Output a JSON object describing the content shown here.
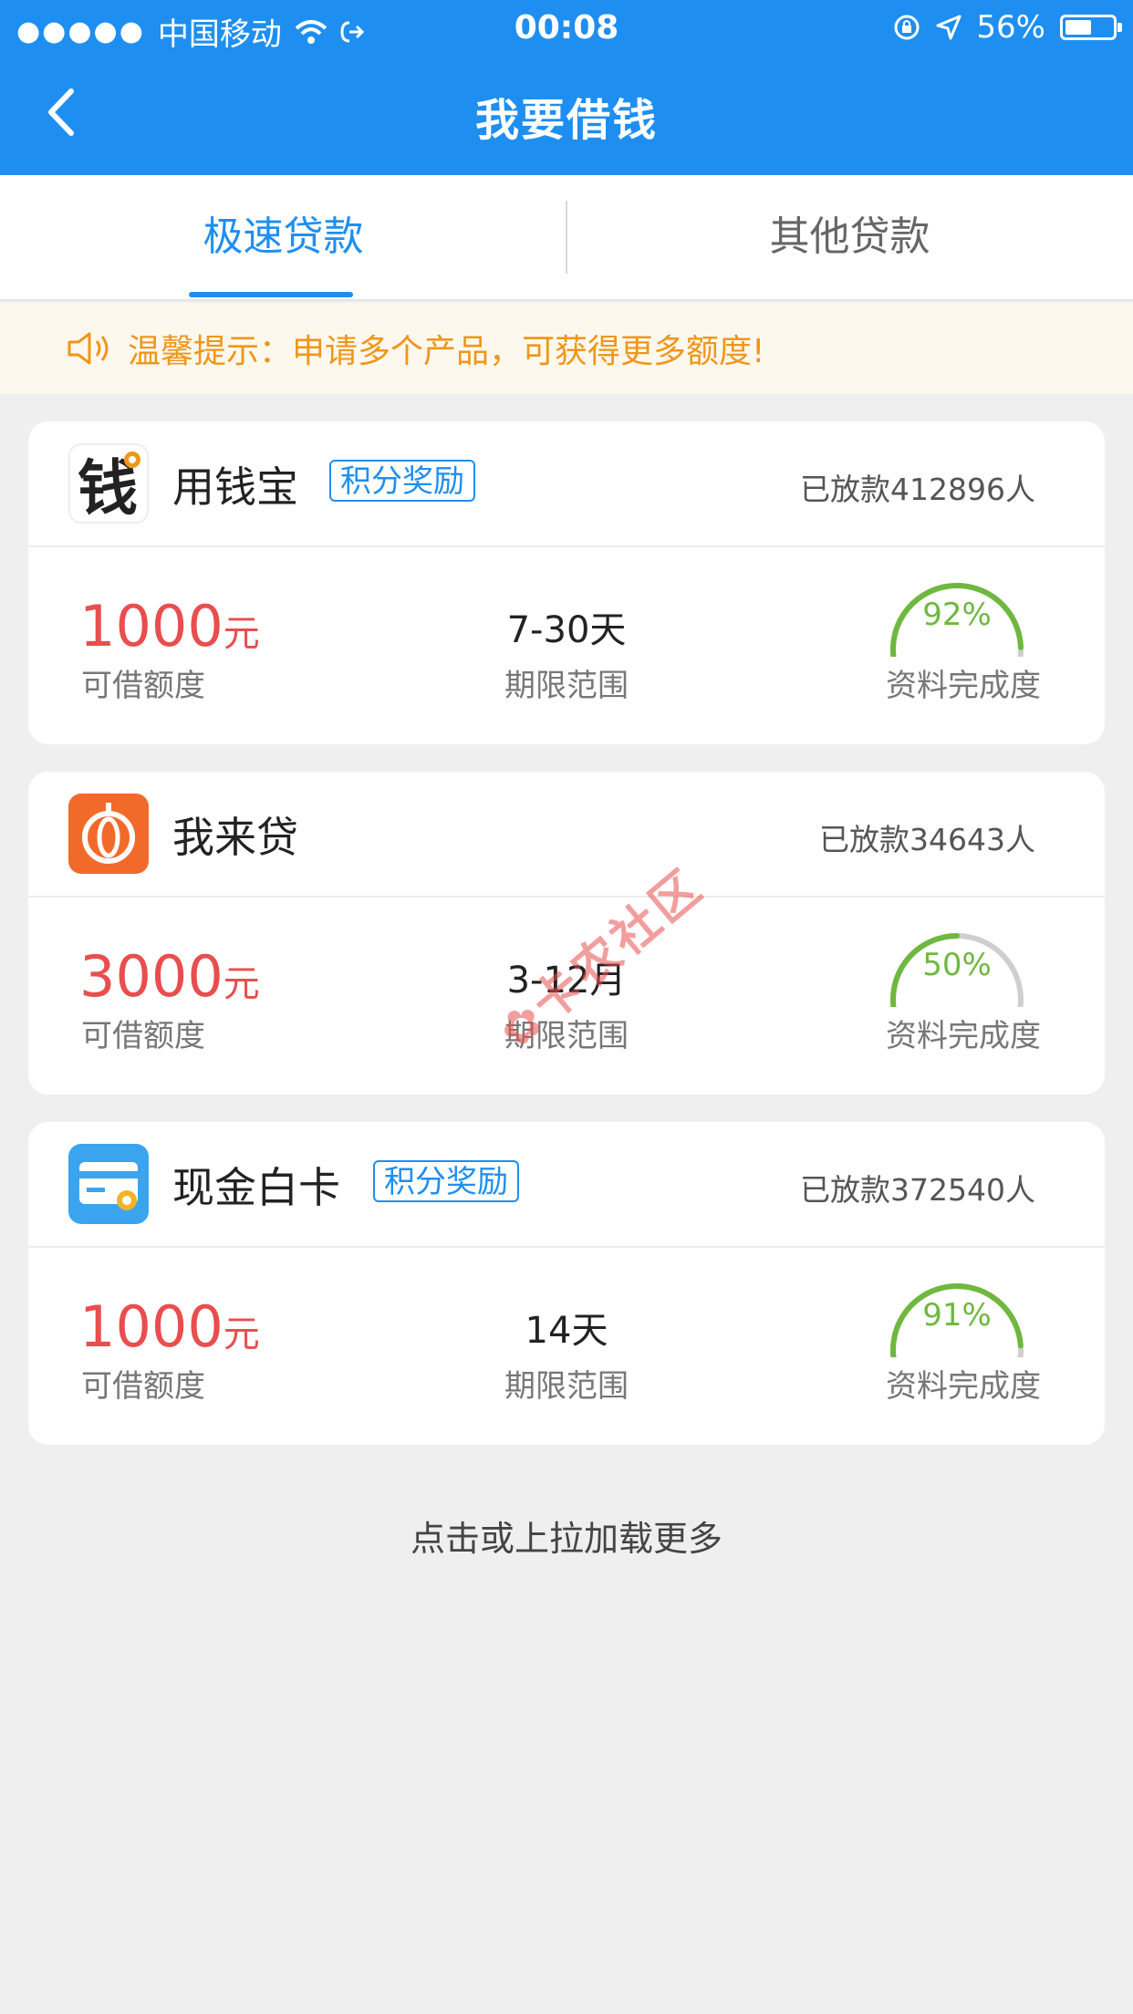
{
  "status_bar": {
    "signal": "●●●●●",
    "carrier": "中国移动",
    "time": "00:08",
    "battery_percent": "56%",
    "battery_level": 0.56
  },
  "nav": {
    "title": "我要借钱"
  },
  "tabs": [
    {
      "label": "极速贷款",
      "active": true
    },
    {
      "label": "其他贷款",
      "active": false
    }
  ],
  "tip": {
    "text": "温馨提示：申请多个产品，可获得更多额度!"
  },
  "labels": {
    "amount": "可借额度",
    "term": "期限范围",
    "completion": "资料完成度",
    "currency_unit": "元"
  },
  "products": [
    {
      "name": "用钱宝",
      "badge": "积分奖励",
      "lent_count": "已放款412896人",
      "amount": "1000",
      "term": "7-30天",
      "completion_text": "92%",
      "completion": 0.92,
      "icon": "qian-logo-icon"
    },
    {
      "name": "我来贷",
      "badge": "",
      "lent_count": "已放款34643人",
      "amount": "3000",
      "term": "3-12月",
      "completion_text": "50%",
      "completion": 0.5,
      "icon": "wolaidai-logo-icon"
    },
    {
      "name": "现金白卡",
      "badge": "积分奖励",
      "lent_count": "已放款372540人",
      "amount": "1000",
      "term": "14天",
      "completion_text": "91%",
      "completion": 0.91,
      "icon": "card-logo-icon"
    }
  ],
  "load_more": "点击或上拉加载更多",
  "watermark": "卡农社区",
  "colors": {
    "primary": "#1e8ff0",
    "amount_red": "#e84e4e",
    "gauge_green": "#6fb83f",
    "tip_orange": "#f0961a",
    "tip_bg": "#fcf8ee"
  }
}
